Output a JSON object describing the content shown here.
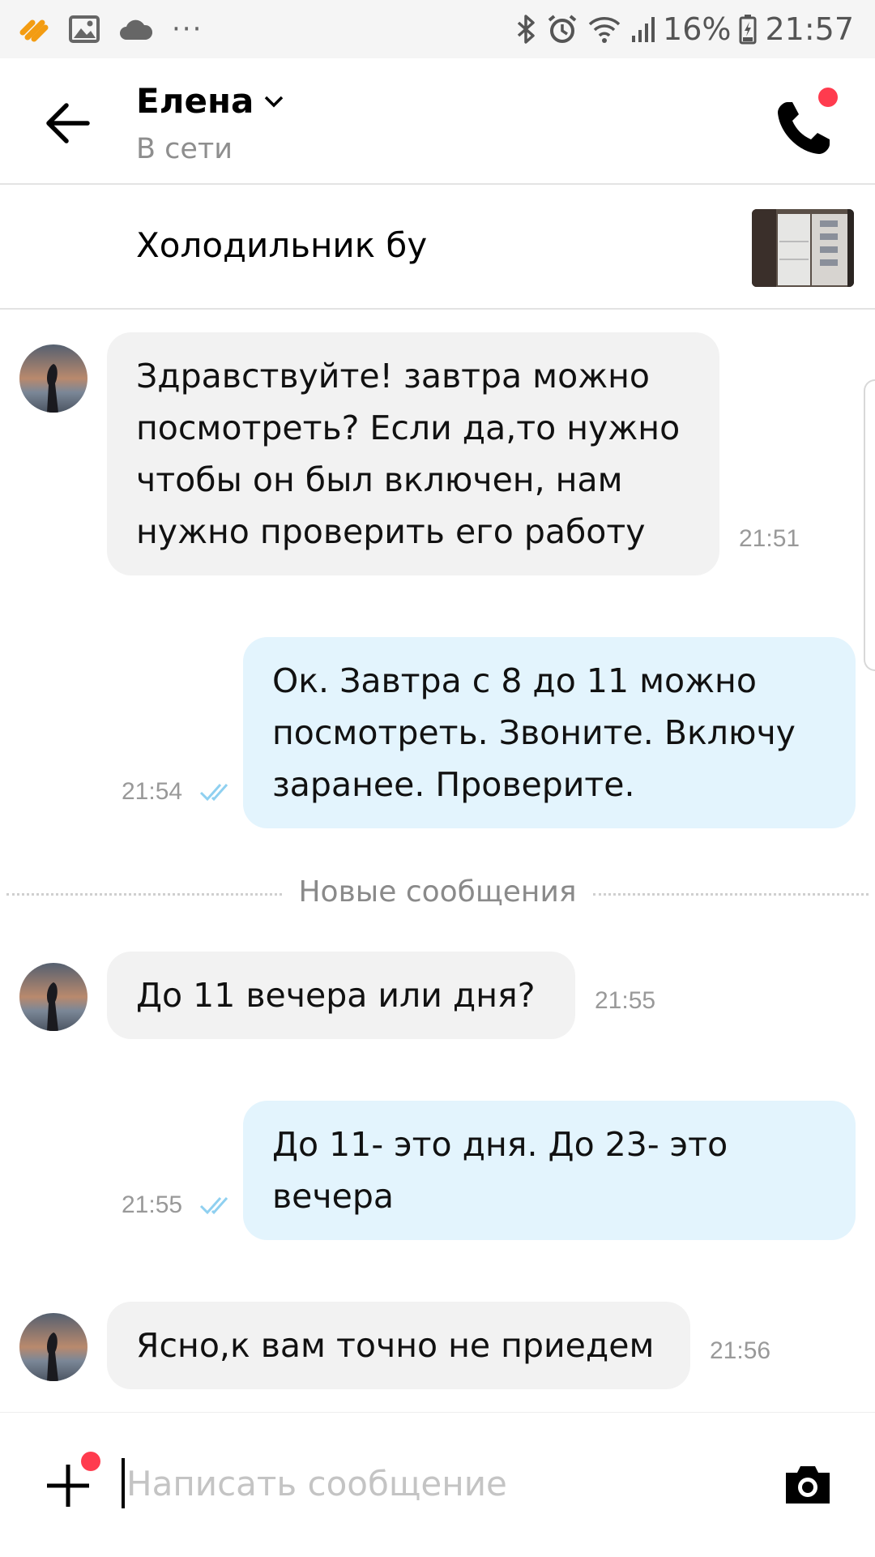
{
  "status_bar": {
    "battery": "16%",
    "time": "21:57",
    "icons": [
      "app-notification-icon",
      "gallery-icon",
      "cloud-icon",
      "more-icon",
      "bluetooth-icon",
      "alarm-icon",
      "wifi-icon",
      "signal-icon",
      "battery-icon"
    ],
    "more": "···"
  },
  "header": {
    "name": "Елена",
    "status": "В сети"
  },
  "listing": {
    "title": "Холодильник бу"
  },
  "messages": [
    {
      "direction": "in",
      "text": "Здравствуйте! завтра можно посмотреть? Если да,то нужно чтобы он был включен, нам нужно проверить его работу",
      "time": "21:51"
    },
    {
      "direction": "out",
      "text": "Ок. Завтра с 8 до 11 можно посмотреть. Звоните. Включу заранее. Проверите.",
      "time": "21:54",
      "read": true
    },
    {
      "direction": "in",
      "text": "До 11 вечера или дня?",
      "time": "21:55"
    },
    {
      "direction": "out",
      "text": "До 11- это дня. До 23- это вечера",
      "time": "21:55",
      "read": true
    },
    {
      "direction": "in",
      "text": "Ясно,к вам точно не приедем",
      "time": "21:56"
    }
  ],
  "divider": {
    "label": "Новые сообщения"
  },
  "composer": {
    "placeholder": "Написать сообщение"
  },
  "colors": {
    "incoming_bubble": "#f2f2f2",
    "outgoing_bubble": "#e3f4fd",
    "notification_dot": "#ff3b4e",
    "read_checks": "#8fd0f0"
  }
}
